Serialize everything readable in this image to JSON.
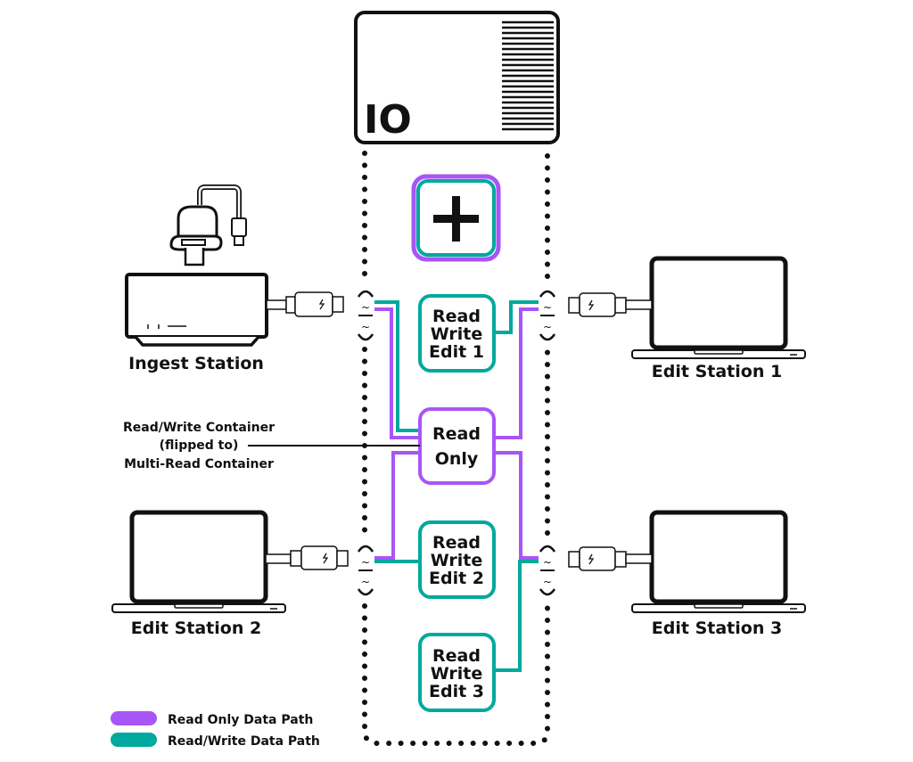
{
  "colors": {
    "read_only": "#A855F7",
    "read_write": "#00A99D",
    "ink": "#111111"
  },
  "storage": {
    "label": "IO"
  },
  "add_button": {
    "icon": "plus-icon"
  },
  "stations": {
    "ingest": "Ingest Station",
    "edit1": "Edit Station 1",
    "edit2": "Edit Station 2",
    "edit3": "Edit Station 3"
  },
  "containers": {
    "rw1": [
      "Read",
      "Write",
      "Edit 1"
    ],
    "ro": [
      "Read",
      "Only"
    ],
    "rw2": [
      "Read",
      "Write",
      "Edit 2"
    ],
    "rw3": [
      "Read",
      "Write",
      "Edit 3"
    ]
  },
  "annotation": {
    "lines": [
      "Read/Write Container",
      "(flipped to)",
      "Multi-Read Container"
    ]
  },
  "legend": [
    {
      "label": "Read Only Data Path",
      "color": "#A855F7"
    },
    {
      "label": "Read/Write Data Path",
      "color": "#00A99D"
    }
  ],
  "connectors": {
    "icon": "thunderbolt-icon",
    "port_symbol": "~"
  }
}
